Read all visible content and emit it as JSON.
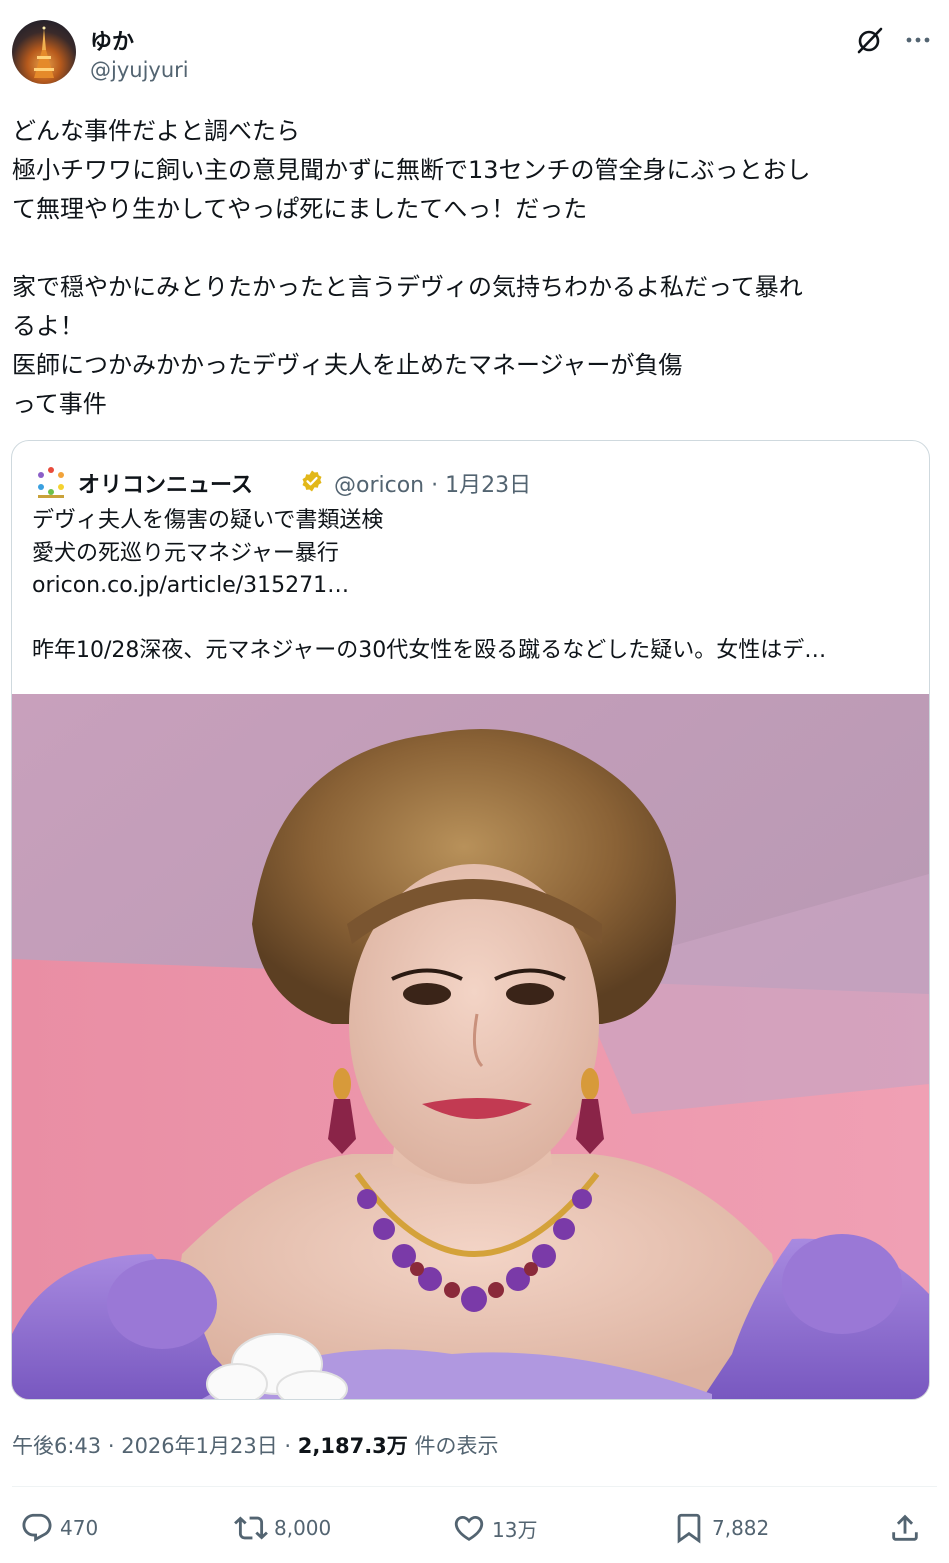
{
  "author": {
    "display_name": "ゆか",
    "handle": "@jyujyuri"
  },
  "icons": {
    "grok": "grok-icon",
    "more": "more-dots-icon",
    "verified": "verified-badge-icon",
    "reply": "reply-icon",
    "repost": "repost-icon",
    "like": "like-icon",
    "bookmark": "bookmark-icon",
    "share": "share-icon"
  },
  "tweet": {
    "text": "どんな事件だよと調べたら\n極小チワワに飼い主の意見聞かずに無断で13センチの管全身にぶっとおし\nて無理やり生かしてやっぱ死にましたてへっ！だった\n\n家で穏やかにみとりたかったと言うデヴィの気持ちわかるよ私だって暴れ\nるよ！\n医師につかみかかったデヴィ夫人を止めたマネージャーが負傷\nって事件"
  },
  "quote": {
    "name": "オリコンニュース",
    "handle": "@oricon",
    "separator": "·",
    "date": "1月23日",
    "lines": [
      "デヴィ夫人を傷害の疑いで書類送検",
      "愛犬の死巡り元マネジャー暴行",
      "oricon.co.jp/article/315271…",
      "",
      "昨年10/28深夜、元マネジャーの30代女性を殴る蹴るなどした疑い。女性はデ…"
    ],
    "logo_colors": [
      "#e84b3c",
      "#f2a33a",
      "#f5d230",
      "#6cc04a",
      "#3aa0e0",
      "#8b5fc8"
    ],
    "verified_color": "#e2b719"
  },
  "meta": {
    "time": "午後6:43",
    "sep1": " · ",
    "date": "2026年1月23日",
    "sep2": " · ",
    "views": "2,187.3万",
    "views_label": " 件の表示"
  },
  "actions": {
    "replies": "470",
    "reposts": "8,000",
    "likes": "13万",
    "bookmarks": "7,882"
  }
}
